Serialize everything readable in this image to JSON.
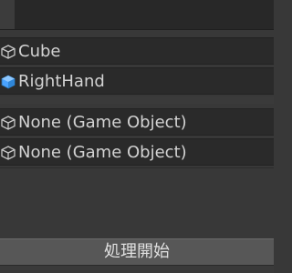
{
  "fields": [
    {
      "label": "Cube",
      "icon": "cube-outline-icon",
      "icon_color": "#c8c8c8"
    },
    {
      "label": "RightHand",
      "icon": "cube-blue-icon",
      "icon_color": "#4aa3ff"
    },
    {
      "label": "None (Game Object)",
      "icon": "cube-outline-icon",
      "icon_color": "#c8c8c8"
    },
    {
      "label": "None (Game Object)",
      "icon": "cube-outline-icon",
      "icon_color": "#c8c8c8"
    }
  ],
  "button": {
    "label": "処理開始"
  }
}
